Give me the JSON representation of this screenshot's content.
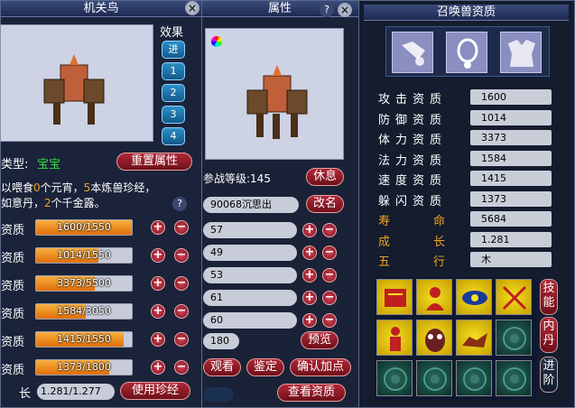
{
  "left": {
    "title": "机关鸟",
    "close": "×",
    "effects_label": "效果",
    "effect_buttons": [
      "进",
      "1",
      "2",
      "3",
      "4"
    ],
    "type_label": "类型:",
    "type_value": "宝宝",
    "reset_btn": "重置属性",
    "feed_line1_a": "以喂食",
    "feed_line1_b": "0",
    "feed_line1_c": "个元宵，",
    "feed_line1_d": "5",
    "feed_line1_e": "本炼兽珍经，",
    "feed_line2_a": "如意丹，",
    "feed_line2_b": "2",
    "feed_line2_c": "个千金露。",
    "help": "?",
    "stats": [
      {
        "label": "资质",
        "text": "1600/1550",
        "fill": 1.0
      },
      {
        "label": "资质",
        "text": "1014/1550",
        "fill": 0.654
      },
      {
        "label": "资质",
        "text": "3373/5500",
        "fill": 0.613
      },
      {
        "label": "资质",
        "text": "1584/3050",
        "fill": 0.519
      },
      {
        "label": "资质",
        "text": "1415/1550",
        "fill": 0.913
      },
      {
        "label": "资质",
        "text": "1373/1800",
        "fill": 0.763
      }
    ],
    "plus": "+",
    "minus": "−",
    "growth_label": "长",
    "growth_value": "1.281/1.277",
    "use_btn": "使用珍经"
  },
  "mid": {
    "title": "属性",
    "help": "?",
    "close": "×",
    "level_label": "参战等级:145",
    "rest_btn": "休息",
    "name_value": "90068沉思出",
    "rename_btn": "改名",
    "attrs": [
      "57",
      "49",
      "53",
      "61",
      "60"
    ],
    "points": "180",
    "preview_btn": "预览",
    "view_btn": "观看",
    "appraise_btn": "鉴定",
    "confirm_btn": "确认加点",
    "check_btn": "查看资质",
    "plus": "+",
    "minus": "−"
  },
  "right": {
    "title": "召唤兽资质",
    "stats": [
      {
        "label": "攻击资质",
        "value": "1600",
        "color": "#ffffff"
      },
      {
        "label": "防御资质",
        "value": "1014",
        "color": "#ffffff"
      },
      {
        "label": "体力资质",
        "value": "3373",
        "color": "#ffffff"
      },
      {
        "label": "法力资质",
        "value": "1584",
        "color": "#ffffff"
      },
      {
        "label": "速度资质",
        "value": "1415",
        "color": "#ffffff"
      },
      {
        "label": "躲闪资质",
        "value": "1373",
        "color": "#ffffff"
      },
      {
        "label": "寿命",
        "value": "5684",
        "color": "#f0a020"
      },
      {
        "label": "成长",
        "value": "1.281",
        "color": "#f0a020"
      },
      {
        "label": "五行",
        "value": "木",
        "color": "#f0a020"
      }
    ],
    "side_tabs": [
      "技能",
      "内丹",
      "进阶"
    ],
    "equip_icons": [
      "helmet-icon",
      "necklace-icon",
      "armor-icon"
    ],
    "skills": [
      "book-skill-icon",
      "monk-skill-icon",
      "eye-skill-icon",
      "swords-skill-icon",
      "figure-skill-icon",
      "owl-skill-icon",
      "beast-skill-icon",
      "empty",
      "empty",
      "empty",
      "empty",
      "empty"
    ]
  }
}
